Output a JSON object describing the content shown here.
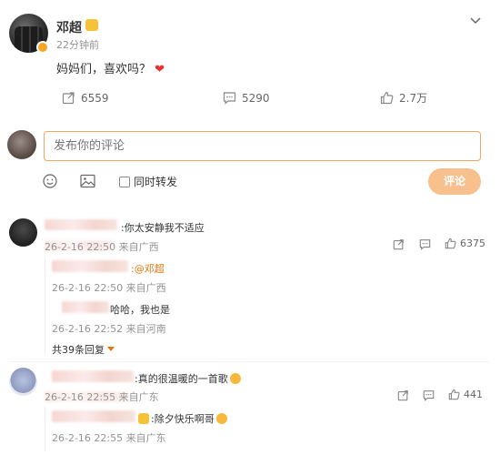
{
  "post": {
    "author": "邓超",
    "time": "22分钟前",
    "text": "妈妈们，喜欢吗？",
    "heart": "❤️",
    "reposts": "6559",
    "comments": "5290",
    "likes": "2.7万"
  },
  "compose": {
    "placeholder": "发布你的评论",
    "repost_label": "同时转发",
    "submit_label": "评论"
  },
  "comments": [
    {
      "text": ":你太安静我不适应",
      "meta": "26-2-16 22:50 来自广西",
      "likes": "6375",
      "replies": [
        {
          "mention": ":@邓超",
          "meta": "26-2-16 22:50 来自广西"
        },
        {
          "text": "哈哈，我也是",
          "meta": "26-2-16 22:52 来自河南"
        }
      ],
      "more_replies": "共39条回复"
    },
    {
      "text": ":真的很温暖的一首歌",
      "meta": "26-2-16 22:55 来自广东",
      "likes": "441",
      "replies": [
        {
          "text": ":除夕快乐啊哥",
          "meta": "26-2-16 22:55 来自广东"
        }
      ]
    }
  ],
  "icons": {
    "chevron": "chevron-down-icon",
    "repost": "share-icon",
    "comment": "comment-icon",
    "like": "thumbs-up-icon",
    "emoji": "smiley-icon",
    "image": "image-icon"
  },
  "colors": {
    "accent": "#e8740c",
    "button_disabled": "#f8c08c",
    "input_border": "#f0a660",
    "heart": "#e5312f"
  }
}
